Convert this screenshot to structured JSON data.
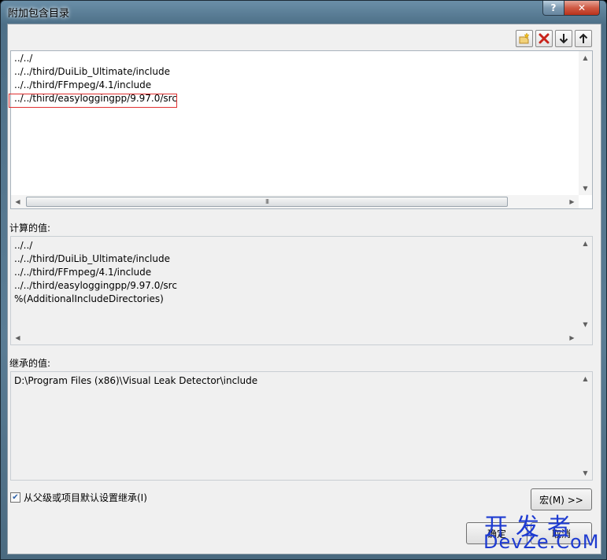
{
  "window": {
    "title": "附加包含目录",
    "help_label": "?",
    "close_label": "✕"
  },
  "toolbar": {
    "icons": [
      "new-line-icon",
      "delete-icon",
      "move-down-icon",
      "move-up-icon"
    ]
  },
  "edit_list": {
    "rows": [
      "../../",
      "../../third/DuiLib_Ultimate/include",
      "../../third/FFmpeg/4.1/include",
      "../../third/easyloggingpp/9.97.0/src"
    ]
  },
  "computed": {
    "label": "计算的值:",
    "rows": [
      "../../",
      "../../third/DuiLib_Ultimate/include",
      "../../third/FFmpeg/4.1/include",
      "../../third/easyloggingpp/9.97.0/src",
      "%(AdditionalIncludeDirectories)"
    ]
  },
  "inherited": {
    "label": "继承的值:",
    "rows": [
      "D:\\Program Files (x86)\\Visual Leak Detector\\include"
    ]
  },
  "inherit_checkbox": {
    "label": "从父级或项目默认设置继承(I)",
    "checked": true
  },
  "buttons": {
    "macro": "宏(M) >>",
    "ok": "确定",
    "cancel": "取消"
  },
  "watermark": {
    "line1": "开发者",
    "line2": "DevZe.CoM"
  },
  "scroll_thumb_grip": "III"
}
